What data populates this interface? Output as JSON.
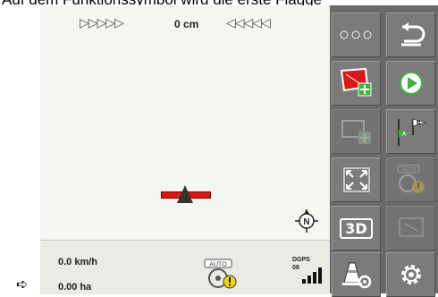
{
  "doc": {
    "top_line": "Auf dem Funktionssymbol wird die erste Flagge",
    "step_arrow": "➪"
  },
  "map": {
    "nav_left": "▷▷▷▷▷",
    "offset": "0 cm",
    "nav_right": "◁◁◁◁◁",
    "north_label": "N"
  },
  "status": {
    "speed": "0.0 km/h",
    "area": "0.00 ha",
    "auto_label": "AUTO",
    "gps_mode": "DGPS",
    "gps_sats": "08"
  },
  "panel": {
    "more_label": "○○○",
    "auto_disabled_label": "AUTO",
    "view_3d_label": "3D",
    "flag_a_label": "A",
    "flag_b_label": "B"
  },
  "colors": {
    "map_bg": "#f5f6f2",
    "panel_bg": "#6a6a6a",
    "boom": "#d61818",
    "play_green": "#3db53d",
    "warn_yellow": "#f2d600"
  }
}
